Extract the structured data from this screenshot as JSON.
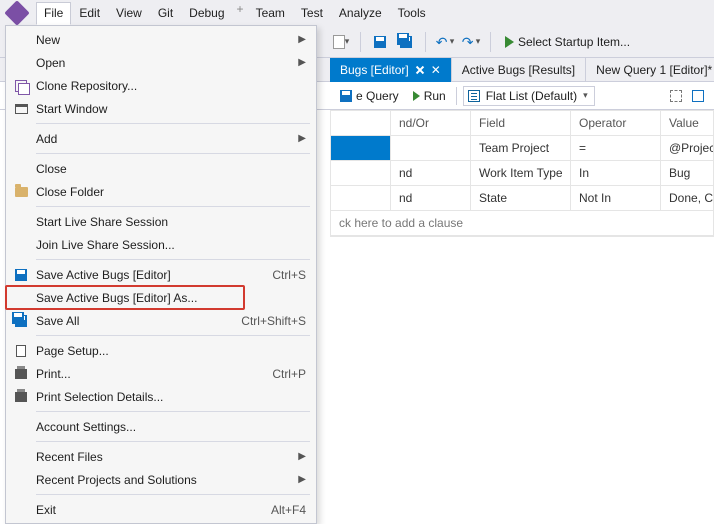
{
  "menubar": [
    "File",
    "Edit",
    "View",
    "Git",
    "Debug",
    "Team",
    "Test",
    "Analyze",
    "Tools"
  ],
  "menubar_active_index": 0,
  "toolbar": {
    "startup_label": "Select Startup Item..."
  },
  "tabs": [
    {
      "label": "Bugs [Editor]",
      "active": true,
      "pinned": true,
      "closable": true
    },
    {
      "label": "Active Bugs [Results]",
      "active": false
    },
    {
      "label": "New Query 1 [Editor]*",
      "active": false
    }
  ],
  "query_toolbar": {
    "save_btn": "e Query",
    "run_btn": "Run",
    "view_label": "Flat List (Default)"
  },
  "grid": {
    "headers": [
      "",
      "nd/Or",
      "Field",
      "Operator",
      "Value"
    ],
    "rows": [
      {
        "andor": "",
        "field": "Team Project",
        "op": "=",
        "val": "@Project",
        "selected": true
      },
      {
        "andor": "nd",
        "field": "Work Item Type",
        "op": "In",
        "val": "Bug"
      },
      {
        "andor": "nd",
        "field": "State",
        "op": "Not In",
        "val": "Done, Completed,"
      }
    ],
    "add_clause_text": "ck here to add a clause"
  },
  "file_menu": {
    "groups": [
      [
        {
          "label": "New",
          "submenu": true
        },
        {
          "label": "Open",
          "submenu": true
        },
        {
          "label": "Clone Repository...",
          "icon": "clone"
        },
        {
          "label": "Start Window",
          "icon": "window"
        }
      ],
      [
        {
          "label": "Add",
          "submenu": true
        }
      ],
      [
        {
          "label": "Close"
        },
        {
          "label": "Close Folder",
          "icon": "folder"
        }
      ],
      [
        {
          "label": "Start Live Share Session"
        },
        {
          "label": "Join Live Share Session..."
        }
      ],
      [
        {
          "label": "Save Active Bugs [Editor]",
          "shortcut": "Ctrl+S",
          "icon": "save"
        },
        {
          "label": "Save Active Bugs [Editor] As...",
          "highlight": true
        },
        {
          "label": "Save All",
          "shortcut": "Ctrl+Shift+S",
          "icon": "save-all"
        }
      ],
      [
        {
          "label": "Page Setup...",
          "icon": "page"
        },
        {
          "label": "Print...",
          "shortcut": "Ctrl+P",
          "icon": "print"
        },
        {
          "label": "Print Selection Details...",
          "icon": "print"
        }
      ],
      [
        {
          "label": "Account Settings..."
        }
      ],
      [
        {
          "label": "Recent Files",
          "submenu": true
        },
        {
          "label": "Recent Projects and Solutions",
          "submenu": true
        }
      ],
      [
        {
          "label": "Exit",
          "shortcut": "Alt+F4"
        }
      ]
    ]
  }
}
